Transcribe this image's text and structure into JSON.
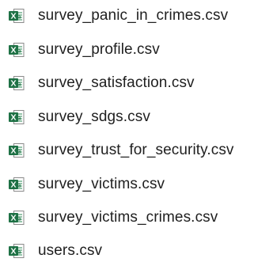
{
  "files": [
    {
      "name": "survey_panic_in_crimes.csv",
      "icon": "excel-csv-file-icon"
    },
    {
      "name": "survey_profile.csv",
      "icon": "excel-csv-file-icon"
    },
    {
      "name": "survey_satisfaction.csv",
      "icon": "excel-csv-file-icon"
    },
    {
      "name": "survey_sdgs.csv",
      "icon": "excel-csv-file-icon"
    },
    {
      "name": "survey_trust_for_security.csv",
      "icon": "excel-csv-file-icon"
    },
    {
      "name": "survey_victims.csv",
      "icon": "excel-csv-file-icon"
    },
    {
      "name": "survey_victims_crimes.csv",
      "icon": "excel-csv-file-icon"
    },
    {
      "name": "users.csv",
      "icon": "excel-csv-file-icon"
    }
  ],
  "colors": {
    "excel_green": "#1E7145",
    "excel_light": "#33A368",
    "sheet_bg": "#ffffff",
    "sheet_border": "#8a8a8a",
    "text": "#1f1f1f"
  }
}
